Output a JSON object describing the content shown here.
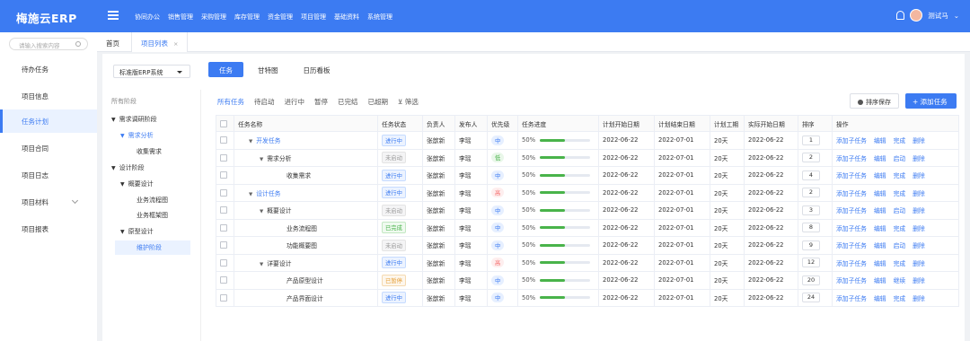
{
  "app": {
    "title": "梅施云ERP",
    "user": "测试马"
  },
  "top_nav": [
    "协同办公",
    "销售管理",
    "采购管理",
    "库存管理",
    "资金管理",
    "项目管理",
    "基础资料",
    "系统管理"
  ],
  "sidebar": {
    "search_placeholder": "请输入搜索内容",
    "items": [
      {
        "label": "待办任务"
      },
      {
        "label": "项目信息"
      },
      {
        "label": "任务计划",
        "active": true
      },
      {
        "label": "项目合同"
      },
      {
        "label": "项目日志"
      },
      {
        "label": "项目材料",
        "has_children": true
      },
      {
        "label": "项目报表"
      }
    ]
  },
  "tabs": [
    {
      "label": "首页"
    },
    {
      "label": "项目列表",
      "active": true,
      "close": "×"
    }
  ],
  "toolbar": {
    "system_select": "标准版ERP系统",
    "views": [
      "任务",
      "甘特图",
      "日历看板"
    ]
  },
  "tree": {
    "header": "所有阶段",
    "nodes": [
      {
        "label": "需求调研阶段"
      },
      {
        "label": "需求分析"
      },
      {
        "label": "收集需求"
      },
      {
        "label": "设计阶段"
      },
      {
        "label": "概要设计"
      },
      {
        "label": "业务流程图"
      },
      {
        "label": "业务框架图"
      },
      {
        "label": "原型设计"
      },
      {
        "label": "维护阶段"
      }
    ]
  },
  "filters": [
    "所有任务",
    "待启动",
    "进行中",
    "暂停",
    "已完结",
    "已超期",
    "筛选"
  ],
  "buttons": {
    "save_sort": "排序保存",
    "add_task": "+ 添加任务"
  },
  "table": {
    "headers": [
      "任务名称",
      "任务状态",
      "负责人",
      "发布人",
      "优先级",
      "任务进度",
      "计划开始日期",
      "计划结束日期",
      "计划工期",
      "实际开始日期",
      "排序",
      "操作"
    ],
    "rows": [
      {
        "name": "开发任务",
        "level": 0,
        "expand": true,
        "status": "进行中",
        "st": "run",
        "owner": "张歆新",
        "pub": "李瑶",
        "pri": "中",
        "pc": "mid",
        "progress": "50%",
        "pv": 0.5,
        "start": "2022-06-22",
        "end": "2022-07-01",
        "dur": "20天",
        "actual": "2022-06-22",
        "order": "1",
        "acts": [
          "添加子任务",
          "编辑",
          "完成",
          "删除"
        ]
      },
      {
        "name": "需求分析",
        "level": 1,
        "expand": true,
        "status": "未启动",
        "st": "off",
        "owner": "张歆新",
        "pub": "李瑶",
        "pri": "低",
        "pc": "low",
        "progress": "50%",
        "pv": 0.5,
        "start": "2022-06-22",
        "end": "2022-07-01",
        "dur": "20天",
        "actual": "2022-06-22",
        "order": "2",
        "acts": [
          "添加子任务",
          "编辑",
          "启动",
          "删除"
        ]
      },
      {
        "name": "收集需求",
        "level": 2,
        "status": "进行中",
        "st": "run",
        "owner": "张歆新",
        "pub": "李瑶",
        "pri": "中",
        "pc": "mid",
        "progress": "50%",
        "pv": 0.5,
        "start": "2022-06-22",
        "end": "2022-07-01",
        "dur": "20天",
        "actual": "2022-06-22",
        "order": "4",
        "acts": [
          "添加子任务",
          "编辑",
          "完成",
          "删除"
        ]
      },
      {
        "name": "设计任务",
        "level": 0,
        "expand": true,
        "status": "进行中",
        "st": "run",
        "owner": "张歆新",
        "pub": "李瑶",
        "pri": "高",
        "pc": "high",
        "progress": "50%",
        "pv": 0.5,
        "start": "2022-06-22",
        "end": "2022-07-01",
        "dur": "20天",
        "actual": "2022-06-22",
        "order": "2",
        "acts": [
          "添加子任务",
          "编辑",
          "完成",
          "删除"
        ]
      },
      {
        "name": "概要设计",
        "level": 1,
        "expand": true,
        "status": "未启动",
        "st": "off",
        "owner": "张歆新",
        "pub": "李瑶",
        "pri": "中",
        "pc": "mid",
        "progress": "50%",
        "pv": 0.5,
        "start": "2022-06-22",
        "end": "2022-07-01",
        "dur": "20天",
        "actual": "2022-06-22",
        "order": "3",
        "acts": [
          "添加子任务",
          "编辑",
          "启动",
          "删除"
        ]
      },
      {
        "name": "业务流程图",
        "level": 2,
        "status": "已完成",
        "st": "done",
        "owner": "张歆新",
        "pub": "李瑶",
        "pri": "中",
        "pc": "mid",
        "progress": "50%",
        "pv": 0.5,
        "start": "2022-06-22",
        "end": "2022-07-01",
        "dur": "20天",
        "actual": "2022-06-22",
        "order": "8",
        "acts": [
          "添加子任务",
          "编辑",
          "完成",
          "删除"
        ]
      },
      {
        "name": "功能概要图",
        "level": 2,
        "status": "未启动",
        "st": "off",
        "owner": "张歆新",
        "pub": "李瑶",
        "pri": "中",
        "pc": "mid",
        "progress": "50%",
        "pv": 0.5,
        "start": "2022-06-22",
        "end": "2022-07-01",
        "dur": "20天",
        "actual": "2022-06-22",
        "order": "9",
        "acts": [
          "添加子任务",
          "编辑",
          "启动",
          "删除"
        ]
      },
      {
        "name": "详要设计",
        "level": 1,
        "expand": true,
        "status": "进行中",
        "st": "run",
        "owner": "张歆新",
        "pub": "李瑶",
        "pri": "高",
        "pc": "high",
        "progress": "50%",
        "pv": 0.5,
        "start": "2022-06-22",
        "end": "2022-07-01",
        "dur": "20天",
        "actual": "2022-06-22",
        "order": "12",
        "acts": [
          "添加子任务",
          "编辑",
          "完成",
          "删除"
        ]
      },
      {
        "name": "产品原型设计",
        "level": 2,
        "status": "已暂停",
        "st": "pause",
        "owner": "张歆新",
        "pub": "李瑶",
        "pri": "中",
        "pc": "mid",
        "progress": "50%",
        "pv": 0.5,
        "start": "2022-06-22",
        "end": "2022-07-01",
        "dur": "20天",
        "actual": "2022-06-22",
        "order": "20",
        "acts": [
          "添加子任务",
          "编辑",
          "继续",
          "删除"
        ]
      },
      {
        "name": "产品界面设计",
        "level": 2,
        "status": "进行中",
        "st": "run",
        "owner": "张歆新",
        "pub": "李瑶",
        "pri": "中",
        "pc": "mid",
        "progress": "50%",
        "pv": 0.5,
        "start": "2022-06-22",
        "end": "2022-07-01",
        "dur": "20天",
        "actual": "2022-06-22",
        "order": "24",
        "acts": [
          "添加子任务",
          "编辑",
          "完成",
          "删除"
        ]
      }
    ]
  }
}
